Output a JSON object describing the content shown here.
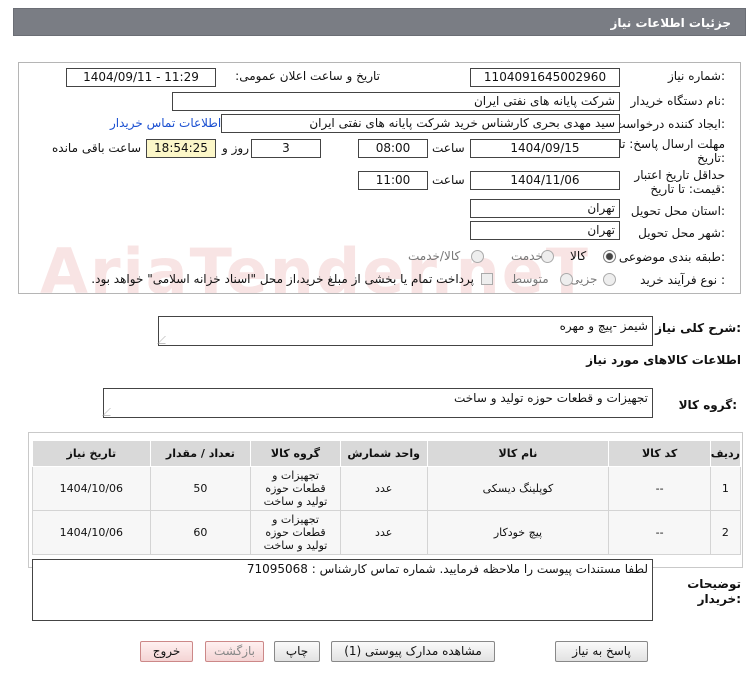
{
  "header": {
    "title": "جزئیات اطلاعات نیاز"
  },
  "form": {
    "need_number_label": "شماره نیاز:",
    "need_number": "1104091645002960",
    "announce_label": "تاریخ و ساعت اعلان عمومی:",
    "announce_value": "1404/09/11 - 11:29",
    "buyer_org_label": "نام دستگاه خریدار:",
    "buyer_org": "شرکت پایانه های نفتی ایران",
    "creator_label": "ایجاد کننده درخواست:",
    "creator": "سید مهدی  بحری کارشناس خرید شرکت پایانه های نفتی ایران",
    "contact_link": "اطلاعات تماس خریدار",
    "reply_deadline_label_1": "مهلت ارسال پاسخ: تا",
    "reply_deadline_label_2": "تاریخ:",
    "reply_date": "1404/09/15",
    "time_label": "ساعت",
    "reply_time": "08:00",
    "days_value": "3",
    "days_label": "روز و",
    "remaining_time": "18:54:25",
    "remaining_label": "ساعت باقی مانده",
    "validity_label_1": "حداقل تاریخ اعتبار",
    "validity_label_2": "قیمت: تا تاریخ:",
    "validity_date": "1404/11/06",
    "validity_time": "11:00",
    "province_label": "استان محل تحویل:",
    "province": "تهران",
    "city_label": "شهر محل تحویل:",
    "city": "تهران",
    "category_label": "طبقه بندی موضوعی:",
    "category_options": [
      "کالا",
      "خدمت",
      "کالا/خدمت"
    ],
    "category_selected": "کالا",
    "process_label": "نوع فرآیند خرید :",
    "process_options": [
      "جزیی",
      "متوسط"
    ],
    "payment_note": "پرداخت تمام یا بخشی از مبلغ خرید،از محل \"اسناد خزانه اسلامی\" خواهد بود."
  },
  "summary": {
    "label": "شرح کلی نیاز:",
    "value": "شیمز -پیچ و مهره"
  },
  "goods": {
    "section_title": "اطلاعات کالاهای مورد نیاز",
    "group_label": "گروه کالا:",
    "group_value": "تجهیزات و قطعات حوزه تولید و ساخت"
  },
  "table": {
    "headers": [
      "ردیف",
      "کد کالا",
      "نام کالا",
      "واحد شمارش",
      "گروه کالا",
      "تعداد / مقدار",
      "تاریخ نیاز"
    ],
    "rows": [
      [
        "1",
        "--",
        "کوپلینگ دیسکی",
        "عدد",
        "تجهیزات و قطعات حوزه تولید و ساخت",
        "50",
        "1404/10/06"
      ],
      [
        "2",
        "--",
        "پیچ خودکار",
        "عدد",
        "تجهیزات و قطعات حوزه تولید و ساخت",
        "60",
        "1404/10/06"
      ]
    ]
  },
  "buyer_notes": {
    "label_1": "توضیحات",
    "label_2": "خریدار:",
    "value": "لطفا مستندات پیوست را ملاحظه فرمایید. شماره تماس کارشناس : 71095068"
  },
  "buttons": {
    "reply": "پاسخ به نیاز",
    "attachments": "مشاهده مدارک پیوستی (1)",
    "print": "چاپ",
    "back": "بازگشت",
    "exit": "خروج"
  },
  "watermark": "AriaTender.neT",
  "colors": {
    "title_bar": "#7a7d84",
    "highlight": "#fcf7c8",
    "link": "#1a4fd1"
  }
}
